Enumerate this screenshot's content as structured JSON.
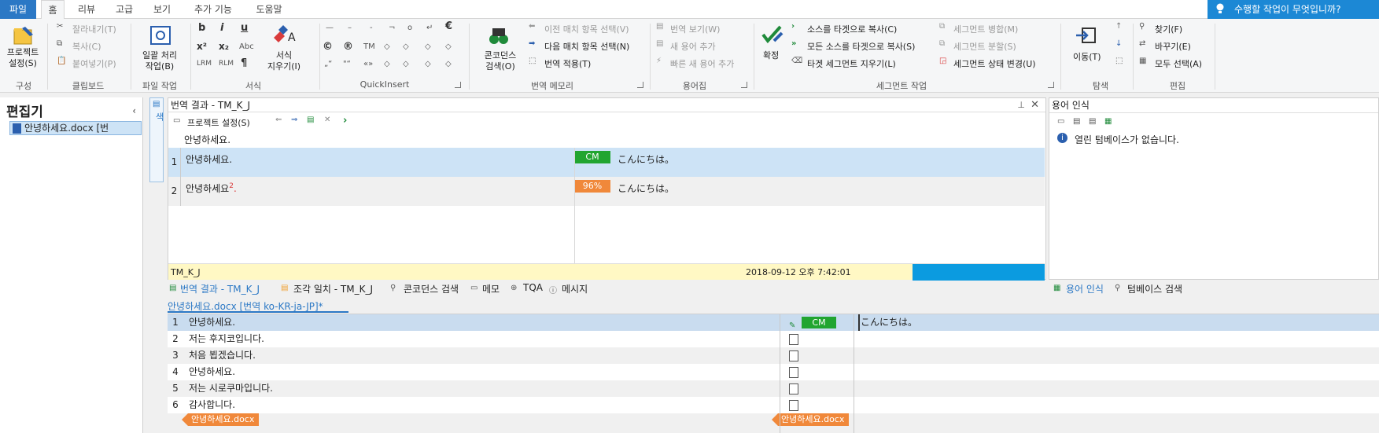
{
  "tabs": [
    "파일",
    "홈",
    "리뷰",
    "고급",
    "보기",
    "추가 기능",
    "도움말"
  ],
  "tellme": "수행할 작업이 무엇입니까?",
  "ribbon": {
    "project_settings": "프로젝트\n설정(S)",
    "grp_config": "구성",
    "cut": "잘라내기(T)",
    "copy": "복사(C)",
    "paste": "붙여넣기(P)",
    "grp_clipboard": "클립보드",
    "batch": "일괄 처리\n작업(B)",
    "grp_filetask": "파일 작업",
    "bold": "b",
    "italic": "i",
    "underline": "u",
    "sup": "x²",
    "sub": "x₂",
    "abc": "Abc",
    "lrm": "LRM",
    "rlm": "RLM",
    "pilcrow": "¶",
    "clear_format": "서식\n지우기(I)",
    "grp_format": "서식",
    "grp_quickinsert": "QuickInsert",
    "concordance": "콘코던스\n검색(O)",
    "prev_match": "이전 매치 항목 선택(V)",
    "next_match": "다음 매치 항목 선택(N)",
    "apply_translation": "번역 적용(T)",
    "grp_tm": "번역 메모리",
    "view_translation": "번역 보기(W)",
    "add_term": "새 용어 추가",
    "quick_add_term": "빠른 새 용어 추가",
    "grp_termbase": "용어집",
    "confirm": "확정",
    "copy_source": "소스를 타겟으로 복사(C)",
    "copy_all_source": "모든 소스를 타겟으로 복사(S)",
    "clear_target": "타겟 세그먼트 지우기(L)",
    "merge_seg": "세그먼트 병합(M)",
    "split_seg": "세그먼트 분할(S)",
    "change_status": "세그먼트 상태 변경(U)",
    "grp_segment": "세그먼트 작업",
    "goto": "이동(T)",
    "grp_nav": "탐색",
    "find": "찾기(F)",
    "replace": "바꾸기(E)",
    "select_all": "모두 선택(A)",
    "grp_edit": "편집"
  },
  "leftnav": {
    "title": "편집기",
    "item": "안녕하세요.docx [번"
  },
  "sidetab": "용어베이스 검색",
  "results": {
    "title": "번역 결과 - TM_K_J",
    "project_settings": "프로젝트 설정(S)",
    "source": "안녕하세요.",
    "rows": [
      {
        "num": "1",
        "src": "안녕하세요.",
        "badge": "CM",
        "badge_color": "#21a530",
        "tgt": "こんにちは。"
      },
      {
        "num": "2",
        "src": "안녕하세요",
        "badge": "96%",
        "badge_color": "#f0883a",
        "tgt": "こんにちは。"
      }
    ],
    "tm_name": "TM_K_J",
    "timestamp": "2018-09-12 오후 7:42:01"
  },
  "terms": {
    "title": "용어 인식",
    "message": "열린 텀베이스가 없습니다."
  },
  "bottom_tabs": [
    "번역 결과 - TM_K_J",
    "조각 일치 - TM_K_J",
    "콘코던스 검색",
    "메모",
    "TQA",
    "메시지"
  ],
  "right_tabs": [
    "용어 인식",
    "텀베이스 검색"
  ],
  "editor": {
    "doc_tab": "안녕하세요.docx [번역 ko-KR-ja-JP]*",
    "rows": [
      {
        "n": "1",
        "s": "안녕하세요.",
        "t": "こんにちは。",
        "status": "CM"
      },
      {
        "n": "2",
        "s": "저는 후지코입니다.",
        "t": "",
        "status": ""
      },
      {
        "n": "3",
        "s": "처음 뵙겠습니다.",
        "t": "",
        "status": ""
      },
      {
        "n": "4",
        "s": "안녕하세요.",
        "t": "",
        "status": ""
      },
      {
        "n": "5",
        "s": "저는 시로쿠마입니다.",
        "t": "",
        "status": ""
      },
      {
        "n": "6",
        "s": "감사합니다.",
        "t": "",
        "status": ""
      }
    ],
    "doc_tag": "안녕하세요.docx"
  }
}
